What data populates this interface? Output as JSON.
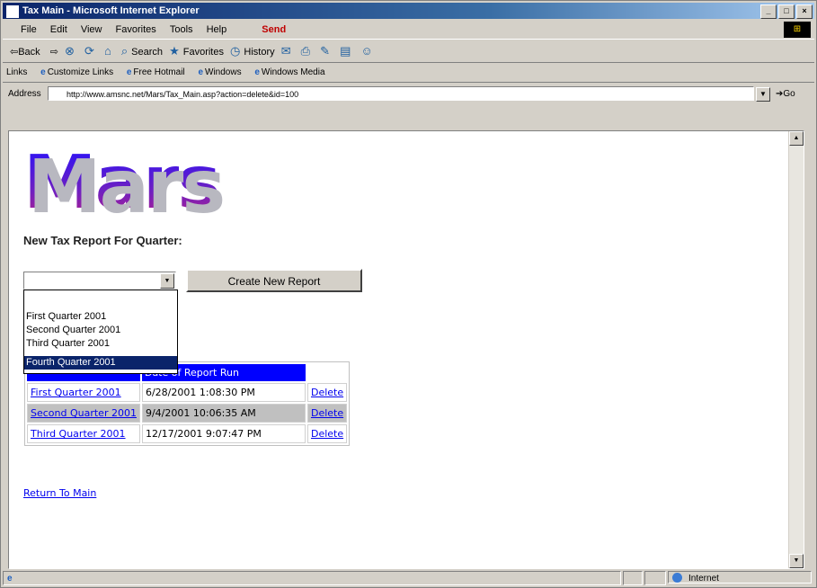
{
  "window": {
    "title": "Tax Main - Microsoft Internet Explorer",
    "buttons": [
      "_",
      "□",
      "×"
    ]
  },
  "menubar": {
    "items": [
      "File",
      "Edit",
      "View",
      "Favorites",
      "Tools",
      "Help"
    ],
    "send_label": "Send"
  },
  "toolbar": {
    "back_label": "⇦Back",
    "forward_label": "⇨",
    "search_label": "Search",
    "favorites_label": "Favorites",
    "history_label": "History"
  },
  "links": {
    "label": "Links",
    "items": [
      "Customize Links",
      "Free Hotmail",
      "Windows",
      "Windows Media"
    ]
  },
  "address": {
    "label": "Address",
    "url": "http://www.amsnc.net/Mars/Tax_Main.asp?action=delete&id=100",
    "go_label": "Go"
  },
  "page": {
    "logo": "Mars",
    "heading": "New Tax Report For Quarter:",
    "select_value": "",
    "create_button": "Create New Report",
    "dropdown_options": [
      "First Quarter 2001",
      "Second Quarter 2001",
      "Third Quarter 2001",
      "Fourth Quarter 2001"
    ],
    "selected_option_index": 3,
    "table": {
      "header": [
        "Date of Report Run"
      ],
      "rows": [
        {
          "quarter": "First Quarter 2001",
          "date": "6/28/2001 1:08:30 PM",
          "action": "Delete"
        },
        {
          "quarter": "Second Quarter 2001",
          "date": "9/4/2001 10:06:35 AM",
          "action": "Delete"
        },
        {
          "quarter": "Third Quarter 2001",
          "date": "12/17/2001 9:07:47 PM",
          "action": "Delete"
        }
      ]
    },
    "return_link": "Return To Main"
  },
  "statusbar": {
    "zone": "Internet"
  }
}
